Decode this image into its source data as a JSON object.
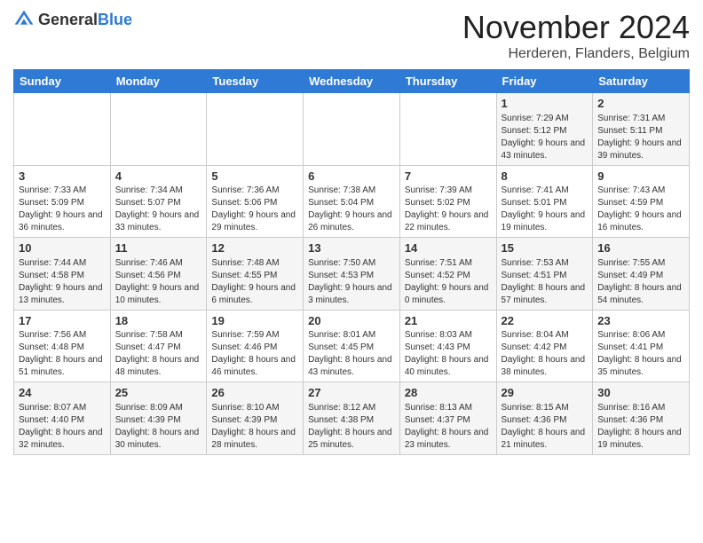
{
  "header": {
    "logo_general": "General",
    "logo_blue": "Blue",
    "month_title": "November 2024",
    "location": "Herderen, Flanders, Belgium"
  },
  "days_of_week": [
    "Sunday",
    "Monday",
    "Tuesday",
    "Wednesday",
    "Thursday",
    "Friday",
    "Saturday"
  ],
  "weeks": [
    [
      {
        "day": "",
        "info": ""
      },
      {
        "day": "",
        "info": ""
      },
      {
        "day": "",
        "info": ""
      },
      {
        "day": "",
        "info": ""
      },
      {
        "day": "",
        "info": ""
      },
      {
        "day": "1",
        "info": "Sunrise: 7:29 AM\nSunset: 5:12 PM\nDaylight: 9 hours and 43 minutes."
      },
      {
        "day": "2",
        "info": "Sunrise: 7:31 AM\nSunset: 5:11 PM\nDaylight: 9 hours and 39 minutes."
      }
    ],
    [
      {
        "day": "3",
        "info": "Sunrise: 7:33 AM\nSunset: 5:09 PM\nDaylight: 9 hours and 36 minutes."
      },
      {
        "day": "4",
        "info": "Sunrise: 7:34 AM\nSunset: 5:07 PM\nDaylight: 9 hours and 33 minutes."
      },
      {
        "day": "5",
        "info": "Sunrise: 7:36 AM\nSunset: 5:06 PM\nDaylight: 9 hours and 29 minutes."
      },
      {
        "day": "6",
        "info": "Sunrise: 7:38 AM\nSunset: 5:04 PM\nDaylight: 9 hours and 26 minutes."
      },
      {
        "day": "7",
        "info": "Sunrise: 7:39 AM\nSunset: 5:02 PM\nDaylight: 9 hours and 22 minutes."
      },
      {
        "day": "8",
        "info": "Sunrise: 7:41 AM\nSunset: 5:01 PM\nDaylight: 9 hours and 19 minutes."
      },
      {
        "day": "9",
        "info": "Sunrise: 7:43 AM\nSunset: 4:59 PM\nDaylight: 9 hours and 16 minutes."
      }
    ],
    [
      {
        "day": "10",
        "info": "Sunrise: 7:44 AM\nSunset: 4:58 PM\nDaylight: 9 hours and 13 minutes."
      },
      {
        "day": "11",
        "info": "Sunrise: 7:46 AM\nSunset: 4:56 PM\nDaylight: 9 hours and 10 minutes."
      },
      {
        "day": "12",
        "info": "Sunrise: 7:48 AM\nSunset: 4:55 PM\nDaylight: 9 hours and 6 minutes."
      },
      {
        "day": "13",
        "info": "Sunrise: 7:50 AM\nSunset: 4:53 PM\nDaylight: 9 hours and 3 minutes."
      },
      {
        "day": "14",
        "info": "Sunrise: 7:51 AM\nSunset: 4:52 PM\nDaylight: 9 hours and 0 minutes."
      },
      {
        "day": "15",
        "info": "Sunrise: 7:53 AM\nSunset: 4:51 PM\nDaylight: 8 hours and 57 minutes."
      },
      {
        "day": "16",
        "info": "Sunrise: 7:55 AM\nSunset: 4:49 PM\nDaylight: 8 hours and 54 minutes."
      }
    ],
    [
      {
        "day": "17",
        "info": "Sunrise: 7:56 AM\nSunset: 4:48 PM\nDaylight: 8 hours and 51 minutes."
      },
      {
        "day": "18",
        "info": "Sunrise: 7:58 AM\nSunset: 4:47 PM\nDaylight: 8 hours and 48 minutes."
      },
      {
        "day": "19",
        "info": "Sunrise: 7:59 AM\nSunset: 4:46 PM\nDaylight: 8 hours and 46 minutes."
      },
      {
        "day": "20",
        "info": "Sunrise: 8:01 AM\nSunset: 4:45 PM\nDaylight: 8 hours and 43 minutes."
      },
      {
        "day": "21",
        "info": "Sunrise: 8:03 AM\nSunset: 4:43 PM\nDaylight: 8 hours and 40 minutes."
      },
      {
        "day": "22",
        "info": "Sunrise: 8:04 AM\nSunset: 4:42 PM\nDaylight: 8 hours and 38 minutes."
      },
      {
        "day": "23",
        "info": "Sunrise: 8:06 AM\nSunset: 4:41 PM\nDaylight: 8 hours and 35 minutes."
      }
    ],
    [
      {
        "day": "24",
        "info": "Sunrise: 8:07 AM\nSunset: 4:40 PM\nDaylight: 8 hours and 32 minutes."
      },
      {
        "day": "25",
        "info": "Sunrise: 8:09 AM\nSunset: 4:39 PM\nDaylight: 8 hours and 30 minutes."
      },
      {
        "day": "26",
        "info": "Sunrise: 8:10 AM\nSunset: 4:39 PM\nDaylight: 8 hours and 28 minutes."
      },
      {
        "day": "27",
        "info": "Sunrise: 8:12 AM\nSunset: 4:38 PM\nDaylight: 8 hours and 25 minutes."
      },
      {
        "day": "28",
        "info": "Sunrise: 8:13 AM\nSunset: 4:37 PM\nDaylight: 8 hours and 23 minutes."
      },
      {
        "day": "29",
        "info": "Sunrise: 8:15 AM\nSunset: 4:36 PM\nDaylight: 8 hours and 21 minutes."
      },
      {
        "day": "30",
        "info": "Sunrise: 8:16 AM\nSunset: 4:36 PM\nDaylight: 8 hours and 19 minutes."
      }
    ]
  ]
}
